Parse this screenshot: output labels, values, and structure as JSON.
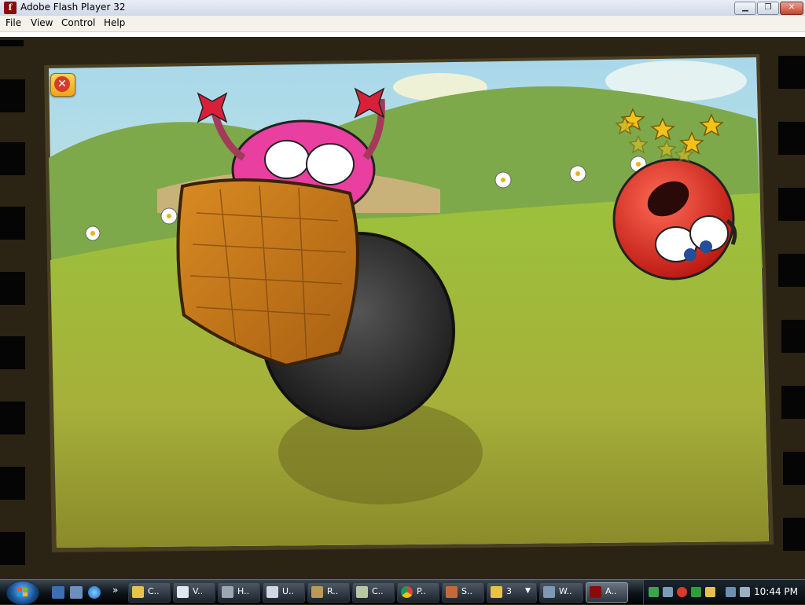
{
  "window": {
    "title": "Adobe Flash Player 32",
    "app_icon_glyph": "f",
    "min_glyph": "▁",
    "max_glyph": "❐",
    "close_glyph": "✕"
  },
  "menu": [
    "File",
    "View",
    "Control",
    "Help"
  ],
  "game": {
    "close_button_glyph": "✕",
    "stars_count": 8,
    "colors": {
      "sky": "#bfe3ef",
      "grass": "#8fb536",
      "red_ball": "#e0261c",
      "pink_ball": "#e93fa0",
      "black_ball": "#2a2a2a",
      "basket": "#c87a1c",
      "film": "#2b2414"
    }
  },
  "taskbar": {
    "start_icon": "windows-orb-icon",
    "quick_launch": [
      "show-desktop-icon",
      "switch-windows-icon",
      "internet-explorer-icon"
    ],
    "quick_launch_more": "»",
    "tasks": [
      {
        "label": "C..",
        "icon": "folder-icon"
      },
      {
        "label": "V..",
        "icon": "document-icon"
      },
      {
        "label": "H..",
        "icon": "paint-icon"
      },
      {
        "label": "U..",
        "icon": "text-icon"
      },
      {
        "label": "R..",
        "icon": "tool-icon"
      },
      {
        "label": "C..",
        "icon": "notepad-icon"
      },
      {
        "label": "P..",
        "icon": "chrome-icon"
      },
      {
        "label": "S..",
        "icon": "app-icon"
      },
      {
        "label": "3",
        "icon": "folder-group-icon"
      },
      {
        "label": "W..",
        "icon": "network-icon"
      },
      {
        "label": "A..",
        "icon": "flash-icon",
        "active": true
      }
    ],
    "clock": "10:44 PM"
  }
}
